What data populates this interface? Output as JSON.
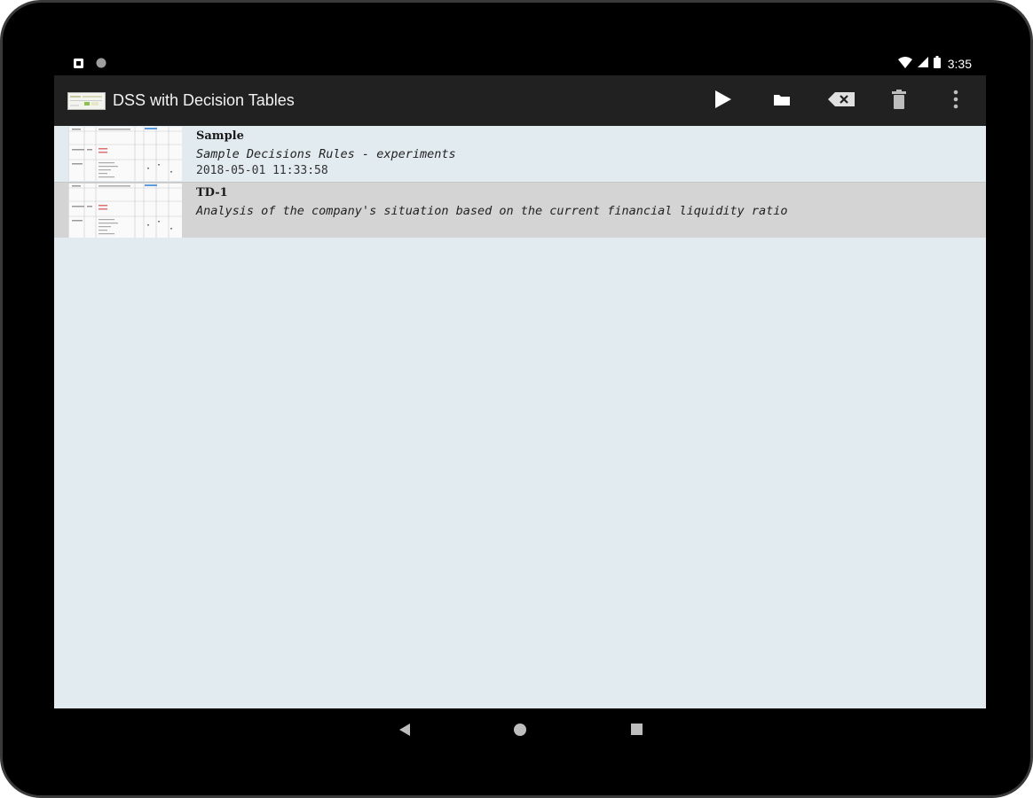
{
  "status_bar": {
    "time": "3:35",
    "icons": [
      "notification-icon",
      "sync-icon",
      "wifi-icon",
      "signal-icon",
      "battery-icon"
    ]
  },
  "app_bar": {
    "title": "DSS with Decision Tables",
    "actions": [
      "play-icon",
      "folder-icon",
      "backspace-icon",
      "trash-icon",
      "more-vert-icon"
    ],
    "background": "#212121"
  },
  "list": {
    "background": "#e2ebf0",
    "selected_background": "#d4d4d4",
    "items": [
      {
        "title": "Sample",
        "description": "Sample Decisions Rules - experiments",
        "date": "2018-05-01 11:33:58"
      },
      {
        "title": "TD-1",
        "description": "Analysis of the company's situation based on the current financial liquidity ratio"
      }
    ]
  },
  "nav_bar": {
    "buttons": [
      "back-icon",
      "home-icon",
      "recents-icon"
    ]
  }
}
